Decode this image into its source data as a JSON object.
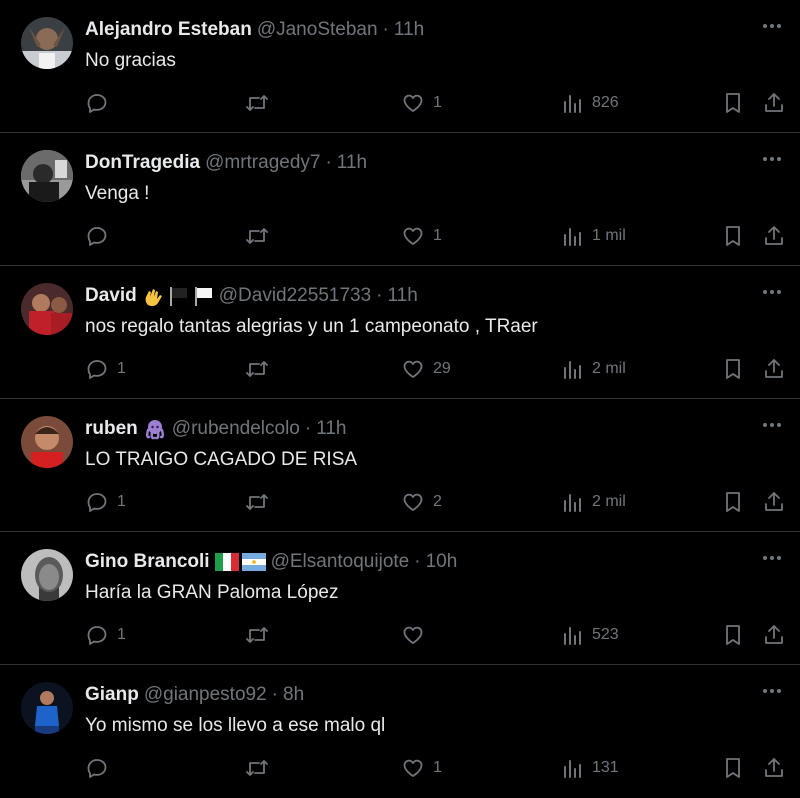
{
  "tweets": [
    {
      "name": "Alejandro Esteban",
      "emoji": [],
      "handle": "@JanoSteban",
      "dot": "·",
      "time": "11h",
      "text": "No gracias",
      "replies": "",
      "likes": "1",
      "views": "826"
    },
    {
      "name": "DonTragedia",
      "emoji": [],
      "handle": "@mrtragedy7",
      "dot": "·",
      "time": "11h",
      "text": "Venga !",
      "replies": "",
      "likes": "1",
      "views": "1 mil"
    },
    {
      "name": "David",
      "emoji": [
        "hand-sign-emoji",
        "black-flag-emoji",
        "white-flag-emoji"
      ],
      "handle": "@David22551733",
      "dot": "·",
      "time": "11h",
      "text": "nos regalo tantas alegrias y un 1 campeonato , TRaer",
      "replies": "1",
      "likes": "29",
      "views": "2 mil"
    },
    {
      "name": "ruben",
      "emoji": [
        "octopus-emoji"
      ],
      "handle": "@rubendelcolo",
      "dot": "·",
      "time": "11h",
      "text": "LO TRAIGO CAGADO DE RISA",
      "replies": "1",
      "likes": "2",
      "views": "2 mil"
    },
    {
      "name": "Gino Brancoli",
      "emoji": [
        "italy-flag-emoji",
        "argentina-flag-emoji"
      ],
      "handle": "@Elsantoquijote",
      "dot": "·",
      "time": "10h",
      "text": "Haría la GRAN Paloma López",
      "replies": "1",
      "likes": "",
      "views": "523"
    },
    {
      "name": "Gianp",
      "emoji": [],
      "handle": "@gianpesto92",
      "dot": "·",
      "time": "8h",
      "text": "Yo mismo se los llevo a ese malo ql",
      "replies": "",
      "likes": "1",
      "views": "131"
    }
  ],
  "colors": {
    "background": "#000000",
    "text": "#e7e9ea",
    "muted": "#71767b",
    "divider": "#2f3336"
  }
}
